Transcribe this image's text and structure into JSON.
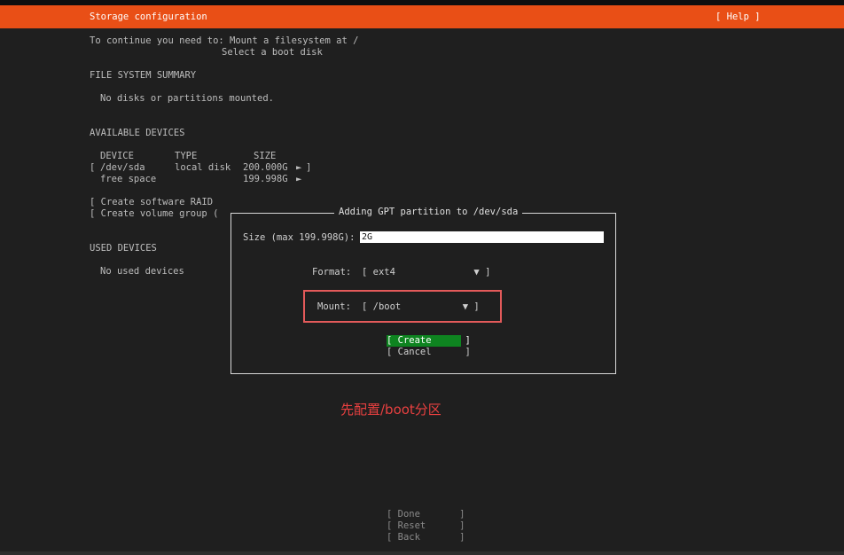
{
  "header": {
    "title": "Storage configuration",
    "help": "[ Help ]",
    "color": "#e94f16"
  },
  "intro": {
    "line1": "To continue you need to: Mount a filesystem at /",
    "line2": "Select a boot disk"
  },
  "fs_summary": {
    "heading": "FILE SYSTEM SUMMARY",
    "empty": "No disks or partitions mounted."
  },
  "available": {
    "heading": "AVAILABLE DEVICES",
    "columns": [
      "DEVICE",
      "TYPE",
      "SIZE"
    ],
    "rows": [
      {
        "bracket_open": "[",
        "device": "/dev/sda",
        "type": "local disk",
        "size": "200.000G",
        "arrow": "►",
        "bracket_close": "]"
      },
      {
        "bracket_open": "",
        "device": "free space",
        "type": "",
        "size": "199.998G",
        "arrow": "►",
        "bracket_close": ""
      }
    ],
    "actions": [
      "[ Create software RAID",
      "[ Create volume group ("
    ]
  },
  "used": {
    "heading": "USED DEVICES",
    "empty": "No used devices"
  },
  "dialog": {
    "title": "Adding GPT partition to /dev/sda",
    "size_label": "Size (max 199.998G):",
    "size_value": "2G",
    "format_label": "Format:",
    "format_value": "[ ext4              ▼ ]",
    "mount_label": "Mount:",
    "mount_value": "[ /boot           ▼ ]",
    "create": "[ Create      ]",
    "cancel": "[ Cancel      ]",
    "create_color": "#0e8420"
  },
  "annotation": {
    "text": "先配置/boot分区",
    "color": "#e84040"
  },
  "footer": {
    "done": "[ Done       ]",
    "reset": "[ Reset      ]",
    "back": "[ Back       ]"
  }
}
